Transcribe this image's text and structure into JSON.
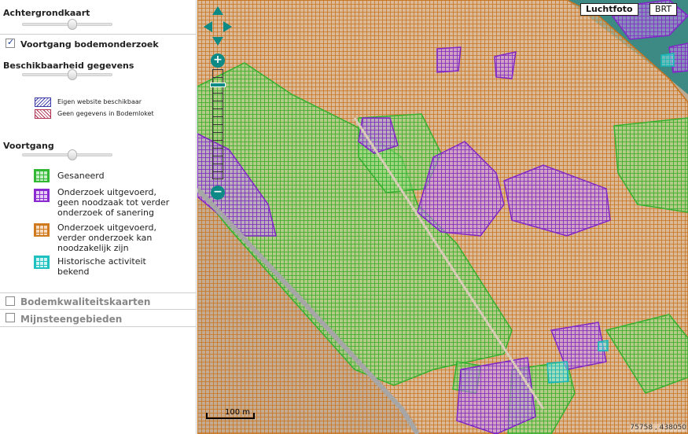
{
  "panel": {
    "background_map": {
      "title": "Achtergrondkaart",
      "slider_value": 0.5
    },
    "progress_layer": {
      "label": "Voortgang bodemonderzoek",
      "checked": true
    },
    "availability": {
      "title": "Beschikbaarheid gegevens",
      "slider_value": 0.5,
      "legend": [
        {
          "label": "Eigen website beschikbaar",
          "color": "#3c3ca8"
        },
        {
          "label": "Geen gegevens in Bodemloket",
          "color": "#b03050"
        }
      ]
    },
    "progress": {
      "title": "Voortgang",
      "slider_value": 0.5,
      "legend": [
        {
          "label": "Gesaneerd",
          "color": "#33b833"
        },
        {
          "label": "Onderzoek uitgevoerd, geen noodzaak tot verder onderzoek of sanering",
          "lines": [
            "Onderzoek uitgevoerd,",
            "geen noodzaak tot verder",
            "onderzoek of sanering"
          ],
          "color": "#8a2ad0"
        },
        {
          "label": "Onderzoek uitgevoerd, verder onderzoek kan noodzakelijk zijn",
          "lines": [
            "Onderzoek uitgevoerd,",
            "verder onderzoek kan",
            "noodzakelijk zijn"
          ],
          "color": "#d07a20"
        },
        {
          "label": "Historische activiteit bekend",
          "lines": [
            "Historische activiteit",
            "bekend"
          ],
          "color": "#1fc0c0"
        }
      ]
    },
    "soil_quality_layer": {
      "label": "Bodemkwaliteitskaarten",
      "checked": false
    },
    "mine_stone_layer": {
      "label": "Mijnsteengebieden",
      "checked": false
    }
  },
  "map": {
    "base_buttons": [
      {
        "label": "Luchtfoto",
        "active": true
      },
      {
        "label": "BRT",
        "active": false
      }
    ],
    "scale_label": "100 m",
    "coordinates": "75758 , 438050",
    "controls": {
      "pan_icons": [
        "pan-up-icon",
        "pan-left-icon",
        "pan-right-icon",
        "pan-down-icon"
      ],
      "zoom_in_icon": "plus-icon",
      "zoom_out_icon": "minus-icon"
    },
    "overlay_colors": {
      "sanitized": "#33b833",
      "no_further_research": "#8a2ad0",
      "further_research": "#d07a20",
      "historic_activity": "#1fc0c0",
      "canal": "#4a8f88",
      "road": "#a6a6a6"
    }
  }
}
